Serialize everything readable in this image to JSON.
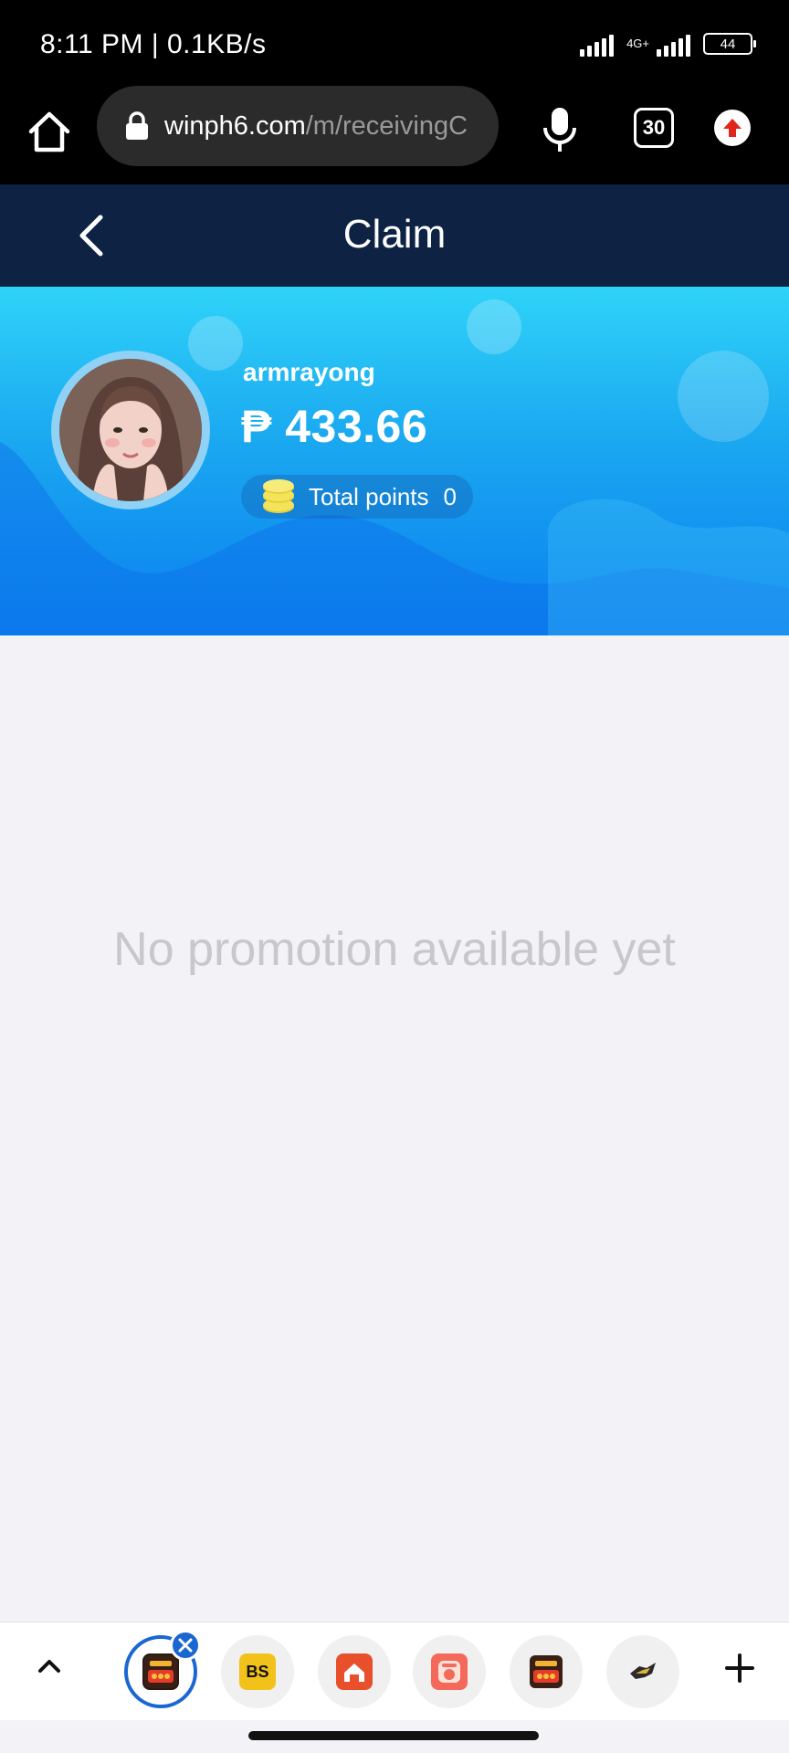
{
  "status_bar": {
    "time": "8:11 PM | 0.1KB/s",
    "network_tag": "4G+",
    "battery": "44"
  },
  "browser": {
    "url_domain": "winph6.com",
    "url_path": "/m/receivingC",
    "tab_count": "30"
  },
  "header": {
    "title": "Claim"
  },
  "profile": {
    "username": "armrayong",
    "balance": "₱ 433.66",
    "points_label": "Total points",
    "points_value": "0"
  },
  "content": {
    "empty_message": "No promotion available yet"
  },
  "bottom_tabs": {
    "items": [
      {
        "icon": "winph-888-favicon"
      },
      {
        "icon": "bs-favicon",
        "label": "BS"
      },
      {
        "icon": "red-house-favicon"
      },
      {
        "icon": "pink-favicon"
      },
      {
        "icon": "winph-888-favicon"
      },
      {
        "icon": "dark-logo-favicon"
      }
    ]
  },
  "colors": {
    "header_bg": "#0e2344",
    "banner_top": "#2fd3f9",
    "banner_bottom": "#0a7ff0",
    "accent_blue": "#1a67d2",
    "coin_yellow": "#f3e35a"
  }
}
